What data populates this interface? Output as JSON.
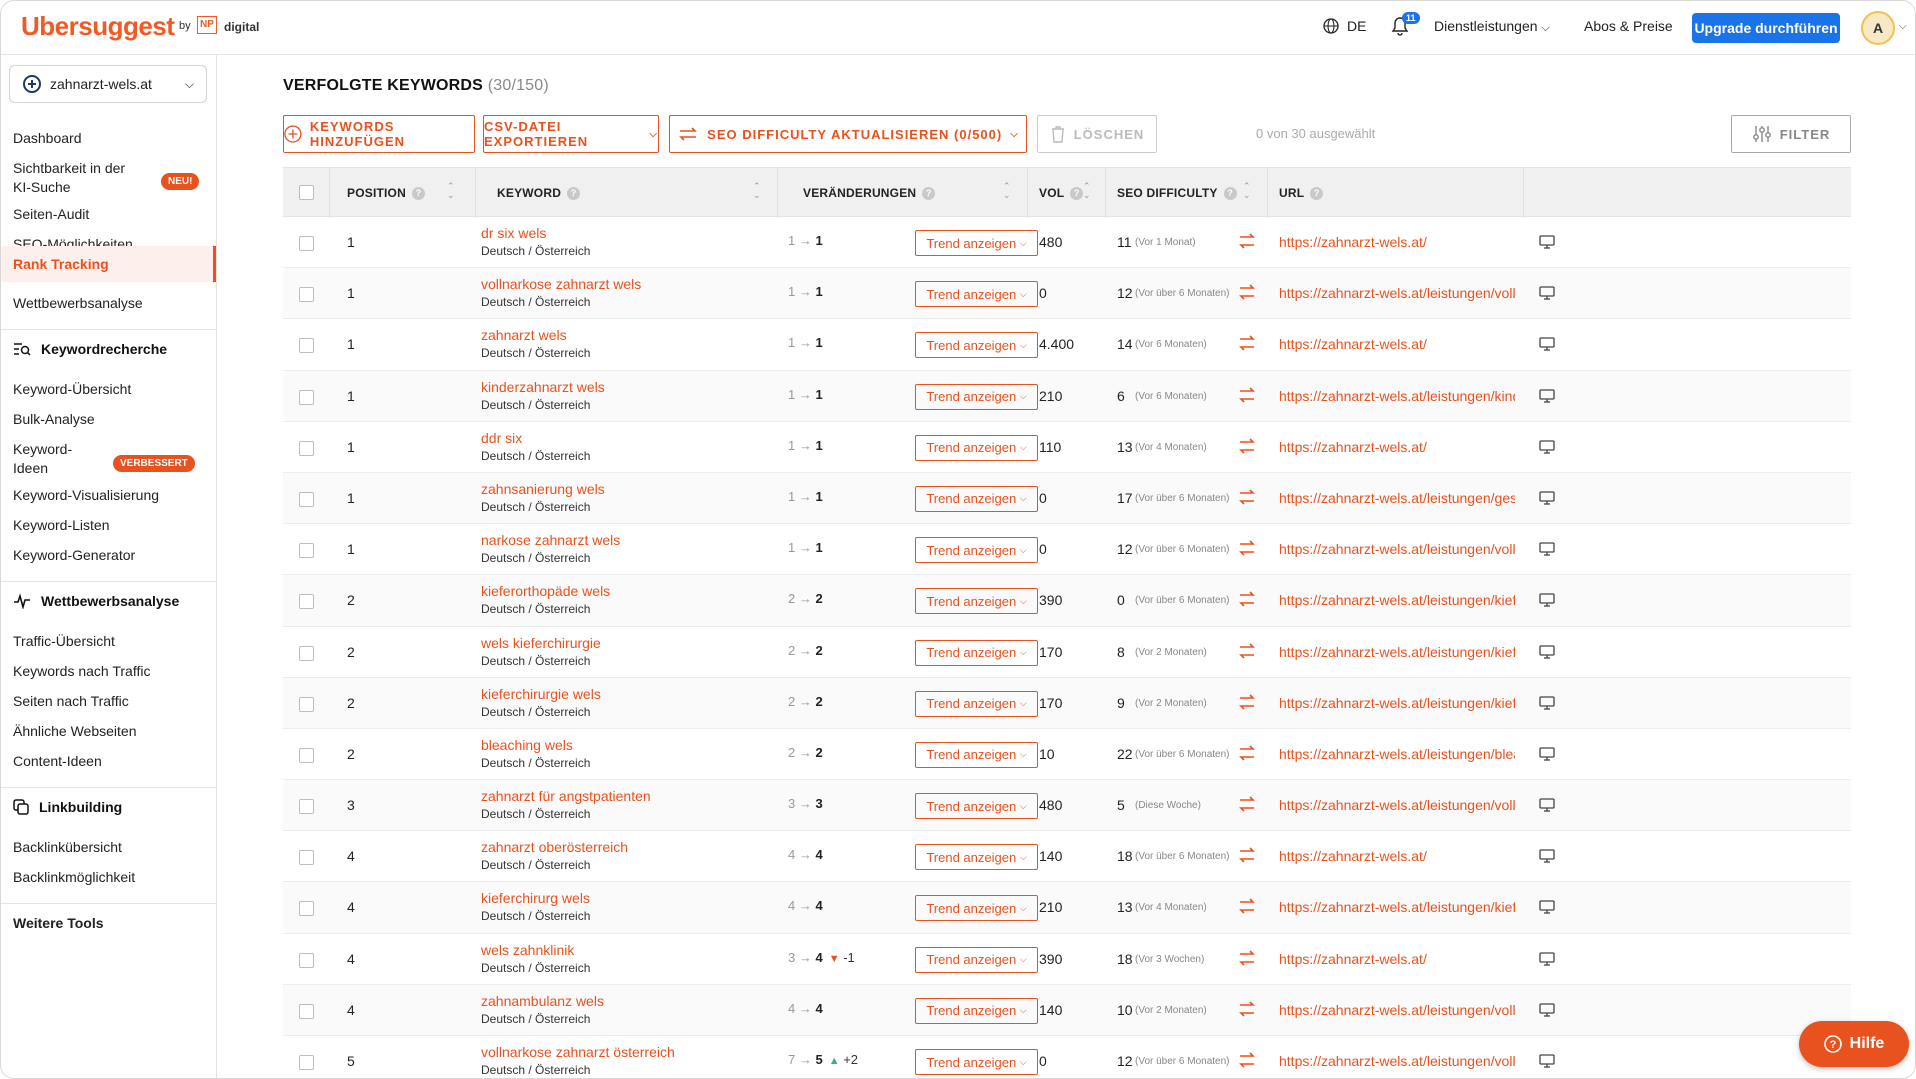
{
  "topbar": {
    "logo": "Ubersuggest",
    "logo_by": "by",
    "logo_np": "NP",
    "logo_digital": "digital",
    "language": "DE",
    "notifications_count": "11",
    "services": "Dienstleistungen",
    "plans": "Abos & Preise",
    "upgrade": "Upgrade durchführen",
    "avatar_initial": "A"
  },
  "sidebar": {
    "domain": "zahnarzt-wels.at",
    "items_top": [
      {
        "label": "Dashboard"
      },
      {
        "label": "Sichtbarkeit in der KI-Suche",
        "badge": "NEU!"
      },
      {
        "label": "Seiten-Audit"
      },
      {
        "label": "SEO-Möglichkeiten"
      },
      {
        "label": "Rank Tracking"
      },
      {
        "label": "Wettbewerbsanalyse"
      }
    ],
    "section_keyword": {
      "title": "Keywordrecherche",
      "items": [
        {
          "label": "Keyword-Übersicht"
        },
        {
          "label": "Bulk-Analyse"
        },
        {
          "label": "Keyword-Ideen",
          "badge": "VERBESSERT"
        },
        {
          "label": "Keyword-Visualisierung"
        },
        {
          "label": "Keyword-Listen"
        },
        {
          "label": "Keyword-Generator"
        }
      ]
    },
    "section_competition": {
      "title": "Wettbewerbsanalyse",
      "items": [
        {
          "label": "Traffic-Übersicht"
        },
        {
          "label": "Keywords nach Traffic"
        },
        {
          "label": "Seiten nach Traffic"
        },
        {
          "label": "Ähnliche Webseiten"
        },
        {
          "label": "Content-Ideen"
        }
      ]
    },
    "section_links": {
      "title": "Linkbuilding",
      "items": [
        {
          "label": "Backlinkübersicht"
        },
        {
          "label": "Backlinkmöglichkeit"
        }
      ]
    },
    "more_tools": "Weitere Tools"
  },
  "main": {
    "title": "VERFOLGTE KEYWORDS",
    "title_count": "(30/150)",
    "buttons": {
      "add": "KEYWORDS HINZUFÜGEN",
      "export": "CSV-DATEI EXPORTIEREN",
      "update_sd": "SEO DIFFICULTY AKTUALISIEREN (0/500)",
      "delete": "LÖSCHEN",
      "filter": "FILTER"
    },
    "selection_info": "0 von 30 ausgewählt",
    "columns": {
      "position": "POSITION",
      "keyword": "KEYWORD",
      "changes": "VERÄNDERUNGEN",
      "vol": "VOL",
      "sd": "SEO DIFFICULTY",
      "url": "URL"
    },
    "trend_label": "Trend anzeigen",
    "rows": [
      {
        "pos": "1",
        "kw": "dr six wels",
        "loc": "Deutsch / Österreich",
        "from": "1",
        "to": "1",
        "delta": "",
        "dir": "",
        "vol": "480",
        "sd": "11",
        "sdn": "(Vor 1 Monat)",
        "url": "https://zahnarzt-wels.at/"
      },
      {
        "pos": "1",
        "kw": "vollnarkose zahnarzt wels",
        "loc": "Deutsch / Österreich",
        "from": "1",
        "to": "1",
        "delta": "",
        "dir": "",
        "vol": "0",
        "sd": "12",
        "sdn": "(Vor über 6 Monaten)",
        "url": "https://zahnarzt-wels.at/leistungen/vollnark..."
      },
      {
        "pos": "1",
        "kw": "zahnarzt wels",
        "loc": "Deutsch / Österreich",
        "from": "1",
        "to": "1",
        "delta": "",
        "dir": "",
        "vol": "4.400",
        "sd": "14",
        "sdn": "(Vor 6 Monaten)",
        "url": "https://zahnarzt-wels.at/"
      },
      {
        "pos": "1",
        "kw": "kinderzahnarzt wels",
        "loc": "Deutsch / Österreich",
        "from": "1",
        "to": "1",
        "delta": "",
        "dir": "",
        "vol": "210",
        "sd": "6",
        "sdn": "(Vor 6 Monaten)",
        "url": "https://zahnarzt-wels.at/leistungen/kinderz..."
      },
      {
        "pos": "1",
        "kw": "ddr six",
        "loc": "Deutsch / Österreich",
        "from": "1",
        "to": "1",
        "delta": "",
        "dir": "",
        "vol": "110",
        "sd": "13",
        "sdn": "(Vor 4 Monaten)",
        "url": "https://zahnarzt-wels.at/"
      },
      {
        "pos": "1",
        "kw": "zahnsanierung wels",
        "loc": "Deutsch / Österreich",
        "from": "1",
        "to": "1",
        "delta": "",
        "dir": "",
        "vol": "0",
        "sd": "17",
        "sdn": "(Vor über 6 Monaten)",
        "url": "https://zahnarzt-wels.at/leistungen/gesamt..."
      },
      {
        "pos": "1",
        "kw": "narkose zahnarzt wels",
        "loc": "Deutsch / Österreich",
        "from": "1",
        "to": "1",
        "delta": "",
        "dir": "",
        "vol": "0",
        "sd": "12",
        "sdn": "(Vor über 6 Monaten)",
        "url": "https://zahnarzt-wels.at/leistungen/vollnark..."
      },
      {
        "pos": "2",
        "kw": "kieferorthopäde wels",
        "loc": "Deutsch / Österreich",
        "from": "2",
        "to": "2",
        "delta": "",
        "dir": "",
        "vol": "390",
        "sd": "0",
        "sdn": "(Vor über 6 Monaten)",
        "url": "https://zahnarzt-wels.at/leistungen/kieferor..."
      },
      {
        "pos": "2",
        "kw": "wels kieferchirurgie",
        "loc": "Deutsch / Österreich",
        "from": "2",
        "to": "2",
        "delta": "",
        "dir": "",
        "vol": "170",
        "sd": "8",
        "sdn": "(Vor 2 Monaten)",
        "url": "https://zahnarzt-wels.at/leistungen/kieferch..."
      },
      {
        "pos": "2",
        "kw": "kieferchirurgie wels",
        "loc": "Deutsch / Österreich",
        "from": "2",
        "to": "2",
        "delta": "",
        "dir": "",
        "vol": "170",
        "sd": "9",
        "sdn": "(Vor 2 Monaten)",
        "url": "https://zahnarzt-wels.at/leistungen/kieferch..."
      },
      {
        "pos": "2",
        "kw": "bleaching wels",
        "loc": "Deutsch / Österreich",
        "from": "2",
        "to": "2",
        "delta": "",
        "dir": "",
        "vol": "10",
        "sd": "22",
        "sdn": "(Vor über 6 Monaten)",
        "url": "https://zahnarzt-wels.at/leistungen/bleachi..."
      },
      {
        "pos": "3",
        "kw": "zahnarzt für angstpatienten",
        "loc": "Deutsch / Österreich",
        "from": "3",
        "to": "3",
        "delta": "",
        "dir": "",
        "vol": "480",
        "sd": "5",
        "sdn": "(Diese Woche)",
        "url": "https://zahnarzt-wels.at/leistungen/vollnark..."
      },
      {
        "pos": "4",
        "kw": "zahnarzt oberösterreich",
        "loc": "Deutsch / Österreich",
        "from": "4",
        "to": "4",
        "delta": "",
        "dir": "",
        "vol": "140",
        "sd": "18",
        "sdn": "(Vor über 6 Monaten)",
        "url": "https://zahnarzt-wels.at/"
      },
      {
        "pos": "4",
        "kw": "kieferchirurg wels",
        "loc": "Deutsch / Österreich",
        "from": "4",
        "to": "4",
        "delta": "",
        "dir": "",
        "vol": "210",
        "sd": "13",
        "sdn": "(Vor 4 Monaten)",
        "url": "https://zahnarzt-wels.at/leistungen/kieferch..."
      },
      {
        "pos": "4",
        "kw": "wels zahnklinik",
        "loc": "Deutsch / Österreich",
        "from": "3",
        "to": "4",
        "delta": "-1",
        "dir": "down",
        "vol": "390",
        "sd": "18",
        "sdn": "(Vor 3 Wochen)",
        "url": "https://zahnarzt-wels.at/"
      },
      {
        "pos": "4",
        "kw": "zahnambulanz wels",
        "loc": "Deutsch / Österreich",
        "from": "4",
        "to": "4",
        "delta": "",
        "dir": "",
        "vol": "140",
        "sd": "10",
        "sdn": "(Vor 2 Monaten)",
        "url": "https://zahnarzt-wels.at/leistungen/vollnark..."
      },
      {
        "pos": "5",
        "kw": "vollnarkose zahnarzt österreich",
        "loc": "Deutsch / Österreich",
        "from": "7",
        "to": "5",
        "delta": "+2",
        "dir": "up",
        "vol": "0",
        "sd": "12",
        "sdn": "(Vor über 6 Monaten)",
        "url": "https://zahnarzt-wels.at/leistungen/vollnark..."
      }
    ]
  },
  "help": "Hilfe",
  "colors": {
    "accent": "#e8521e",
    "primary": "#1a73e8",
    "up": "#3cb371",
    "down": "#e8521e"
  }
}
